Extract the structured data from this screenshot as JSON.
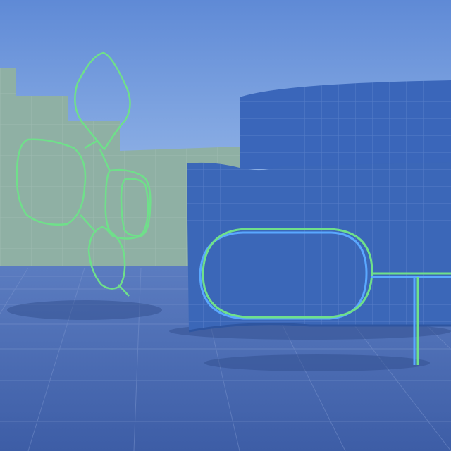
{
  "scene": {
    "type": "3d-viewport",
    "colors": {
      "sky_top": "#5f8ad6",
      "sky_horizon": "#a8c6ee",
      "floor": "#4a6ab0",
      "floor_grid": "#7f98d0",
      "background_wall": "#8fb0a4",
      "wall_front": "#3b67b8",
      "wall_grid": "#6d90d2",
      "outline_green": "#6fe08a",
      "outline_blue": "#5aa8ff"
    },
    "objects": [
      {
        "name": "background-stepped-wall"
      },
      {
        "name": "curved-wall-blue"
      },
      {
        "name": "wireframe-flower-gizmo"
      },
      {
        "name": "capsule-outline-gizmo"
      }
    ]
  }
}
